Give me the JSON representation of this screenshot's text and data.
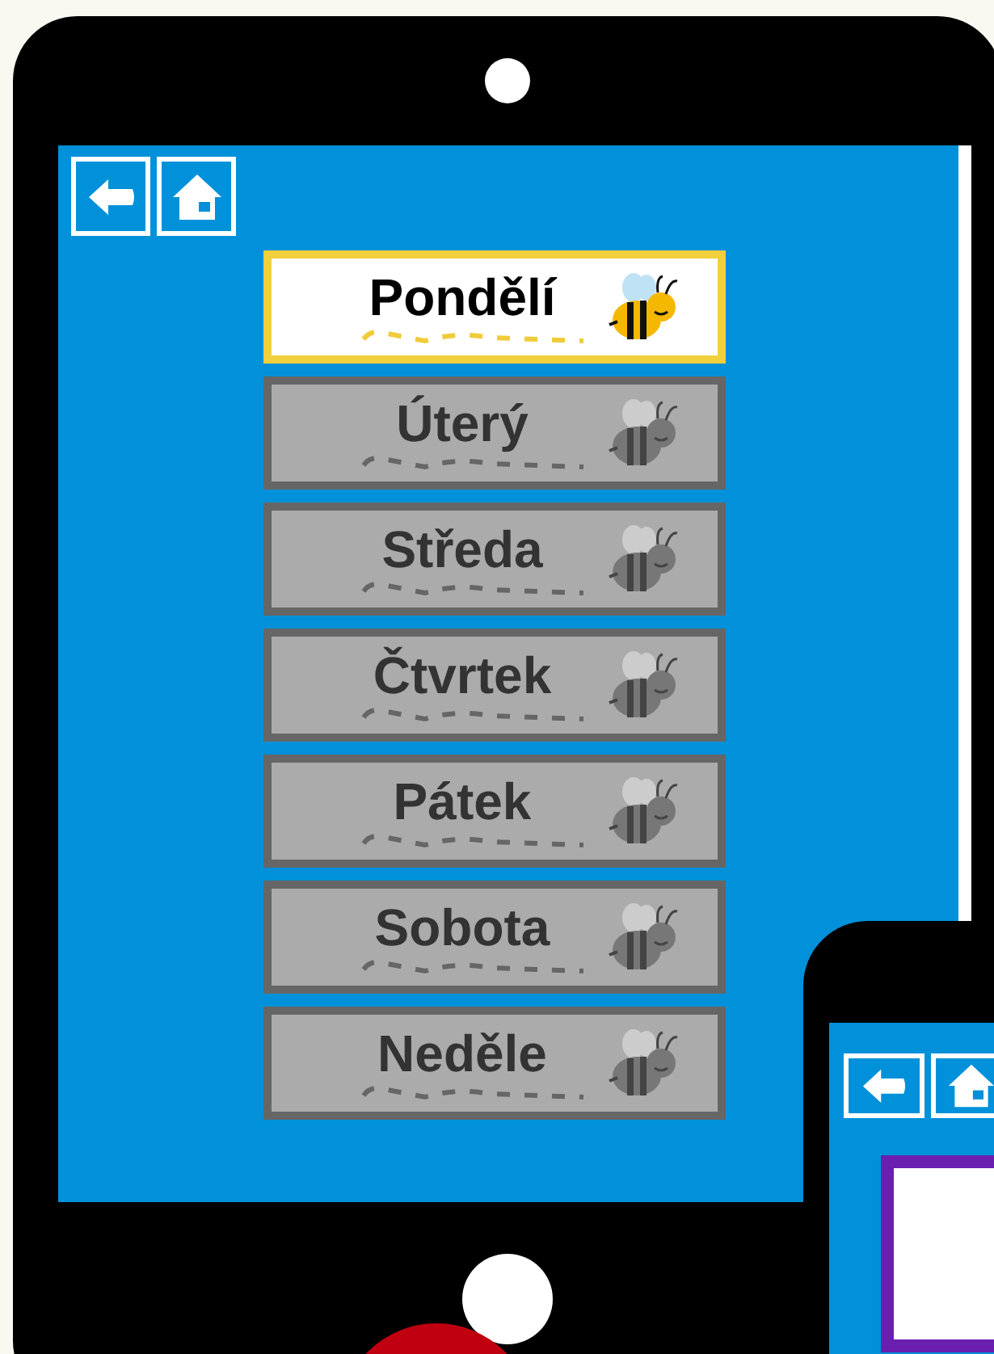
{
  "days": [
    {
      "label": "Pondělí",
      "selected": true
    },
    {
      "label": "Úterý",
      "selected": false
    },
    {
      "label": "Středa",
      "selected": false
    },
    {
      "label": "Čtvrtek",
      "selected": false
    },
    {
      "label": "Pátek",
      "selected": false
    },
    {
      "label": "Sobota",
      "selected": false
    },
    {
      "label": "Neděle",
      "selected": false
    }
  ]
}
